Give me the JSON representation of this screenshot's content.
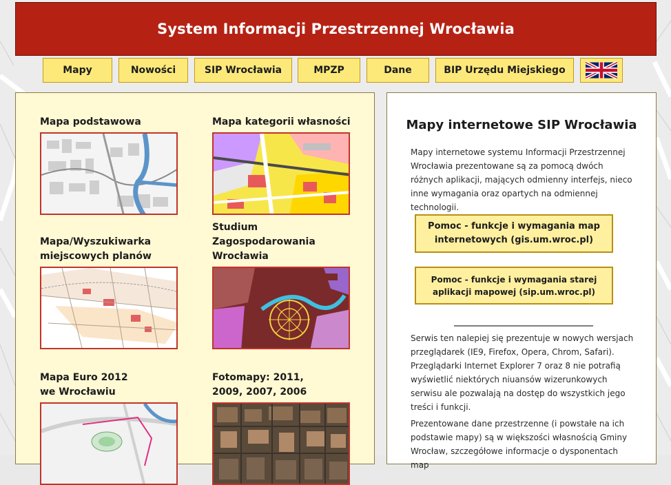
{
  "header": {
    "title": "System Informacji Przestrzennej Wrocławia"
  },
  "nav": {
    "items": [
      {
        "label": "Mapy"
      },
      {
        "label": "Nowości"
      },
      {
        "label": "SIP Wrocławia"
      },
      {
        "label": "MPZP"
      },
      {
        "label": "Dane"
      },
      {
        "label": "BIP Urzędu Miejskiego"
      }
    ],
    "flag_icon": "uk-flag-icon"
  },
  "maps": [
    {
      "title_line1": "Mapa podstawowa",
      "title_line2": "",
      "icon": "basemap-thumbnail"
    },
    {
      "title_line1": "Mapa kategorii własności",
      "title_line2": "",
      "icon": "ownership-map-thumbnail"
    },
    {
      "title_line1": "Mapa/Wyszukiwarka",
      "title_line2": "miejscowych planów",
      "icon": "local-plans-thumbnail"
    },
    {
      "title_line1": "Studium Zagospodarowania",
      "title_line2": "Wrocławia",
      "icon": "study-map-thumbnail"
    },
    {
      "title_line1": "Mapa Euro 2012",
      "title_line2": "we Wrocławiu",
      "icon": "euro2012-map-thumbnail"
    },
    {
      "title_line1": "Fotomapy: 2011,",
      "title_line2": "2009, 2007, 2006",
      "icon": "orthophoto-thumbnail"
    }
  ],
  "info": {
    "title": "Mapy internetowe SIP Wrocławia",
    "intro": "Mapy internetowe systemu Informacji Przestrzennej Wrocławia prezentowane są za pomocą dwóch różnych aplikacji, mających odmienny interfejs, nieco inne wymagania oraz opartych na odmiennej technologii.",
    "help_button_1": "Pomoc - funkcje i wymagania map internetowych (gis.um.wroc.pl)",
    "help_button_2": "Pomoc - funkcje i wymagania starej aplikacji mapowej (sip.um.wroc.pl)",
    "browsers_note": "Serwis ten nalepiej się prezentuje w nowych wersjach przeglądarek (IE9, Firefox, Opera, Chrom, Safari). Przeglądarki Internet Explorer 7 oraz 8 nie potrafią wyświetlić niektórych niuansów wizerunkowych serwisu ale pozwalają na dostęp do wszystkich jego treści i funkcji.",
    "data_note": "Prezentowane dane przestrzenne (i powstałe na ich podstawie mapy) są w większości własnością Gminy Wrocław, szczegółowe informacje o dysponentach map"
  },
  "colors": {
    "header_bg": "#b52214",
    "nav_bg": "#fce97a",
    "left_panel_bg": "#fff9d4",
    "thumb_border": "#c2332a",
    "help_button_bg": "#fff0a0"
  }
}
